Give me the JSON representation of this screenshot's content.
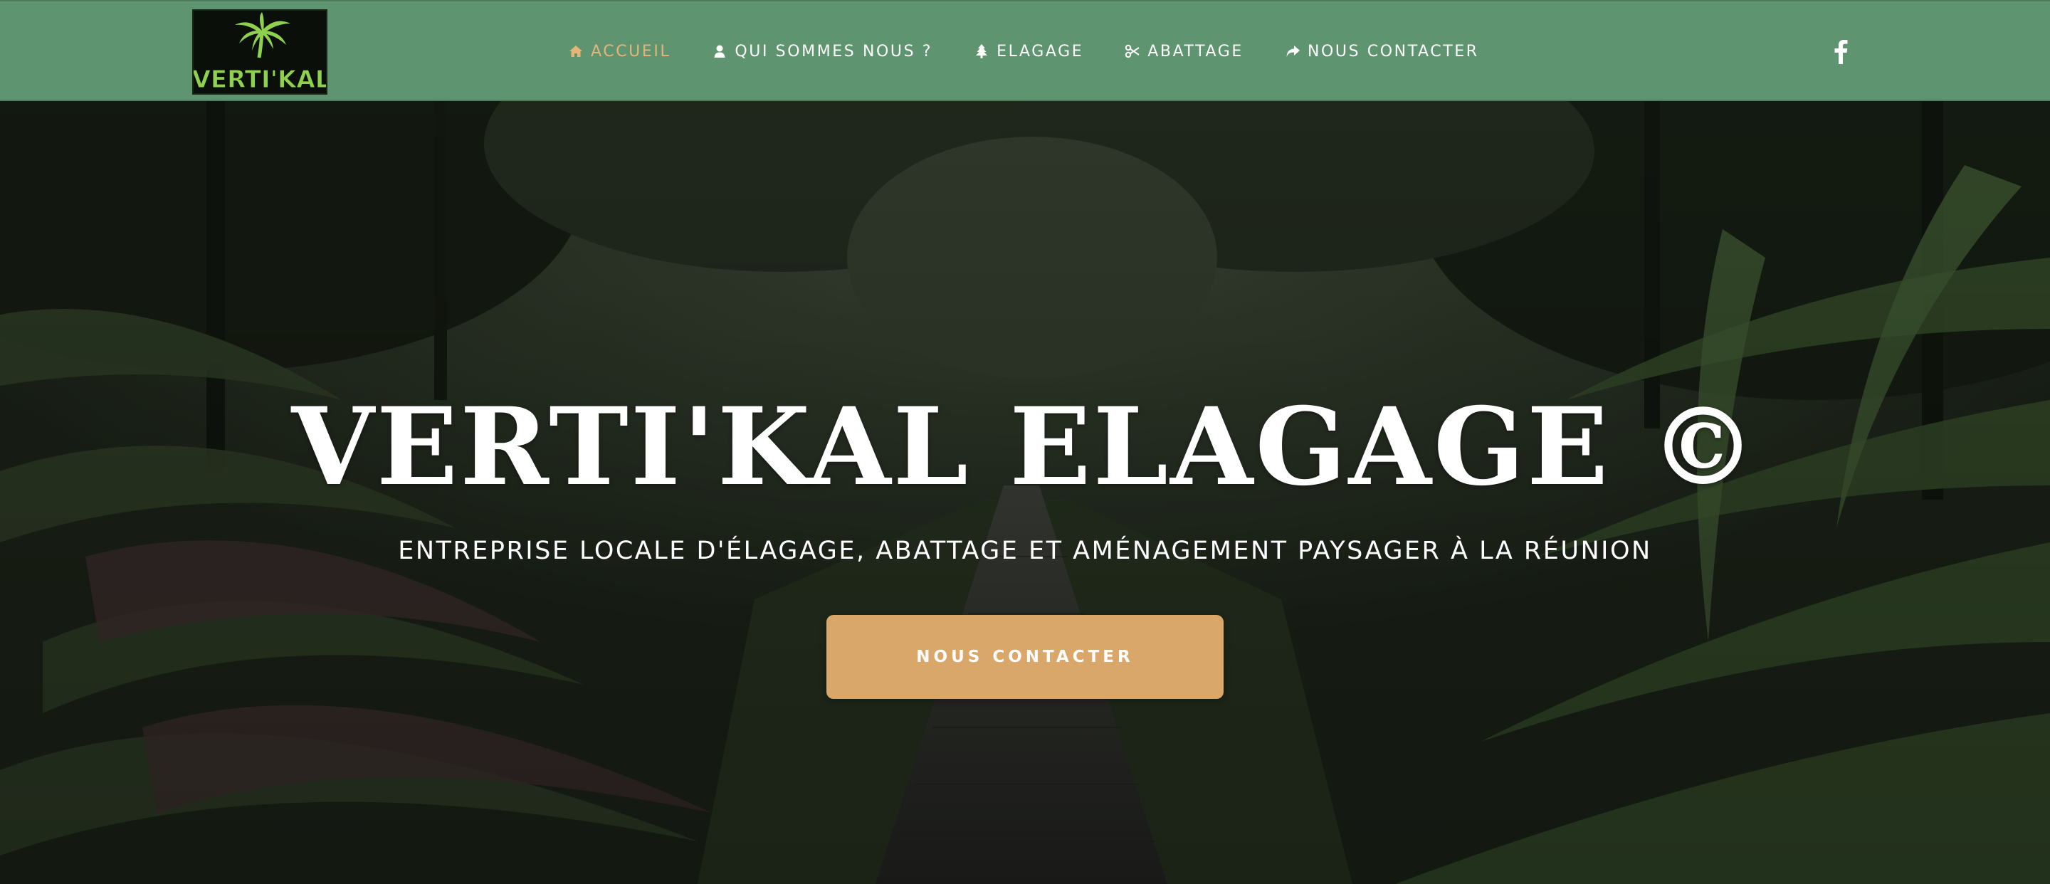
{
  "brand": {
    "logo_text": "VERTI'KAL"
  },
  "nav": {
    "items": [
      {
        "label": "ACCUEIL",
        "icon": "home-icon",
        "active": true
      },
      {
        "label": "QUI SOMMES NOUS ?",
        "icon": "user-icon",
        "active": false
      },
      {
        "label": "ELAGAGE",
        "icon": "tree-icon",
        "active": false
      },
      {
        "label": "ABATTAGE",
        "icon": "scissors-icon",
        "active": false
      },
      {
        "label": "NOUS CONTACTER",
        "icon": "share-arrow-icon",
        "active": false
      }
    ],
    "social": {
      "icon": "facebook-icon",
      "label": "f"
    }
  },
  "hero": {
    "title": "VERTI'KAL ELAGAGE ©",
    "subtitle": "ENTREPRISE LOCALE D'ÉLAGAGE, ABATTAGE ET AMÉNAGEMENT PAYSAGER À LA RÉUNION",
    "cta_label": "NOUS CONTACTER"
  },
  "colors": {
    "header_bg": "#5f9470",
    "nav_active": "#e3b678",
    "nav_text": "#ffffff",
    "cta_bg": "#d9a76a",
    "logo_green": "#8fd14f",
    "hero_overlay": "#1d2419"
  }
}
